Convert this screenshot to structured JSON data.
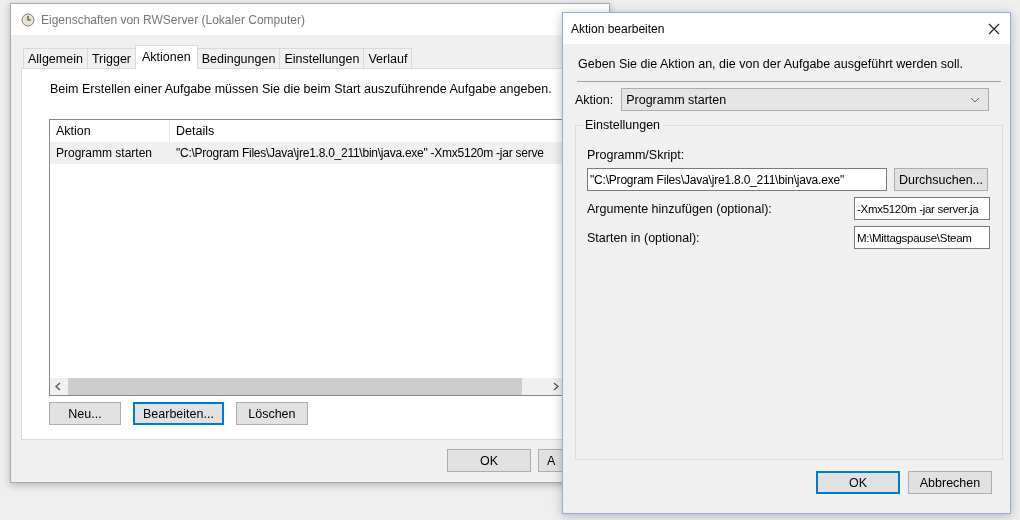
{
  "main_window": {
    "title": "Eigenschaften von RWServer (Lokaler Computer)",
    "tabs": [
      {
        "label": "Allgemein",
        "selected": false
      },
      {
        "label": "Trigger",
        "selected": false
      },
      {
        "label": "Aktionen",
        "selected": true
      },
      {
        "label": "Bedingungen",
        "selected": false
      },
      {
        "label": "Einstellungen",
        "selected": false
      },
      {
        "label": "Verlauf",
        "selected": false
      }
    ],
    "instruction": "Beim Erstellen einer Aufgabe müssen Sie die beim Start auszuführende Aufgabe angeben.",
    "actions_table": {
      "columns": [
        "Aktion",
        "Details"
      ],
      "rows": [
        {
          "cells": [
            "Programm starten",
            "\"C:\\Program Files\\Java\\jre1.8.0_211\\bin\\java.exe\" -Xmx5120m -jar serve"
          ],
          "selected": true
        }
      ]
    },
    "buttons": [
      {
        "label": "Neu...",
        "focused": false
      },
      {
        "label": "Bearbeiten...",
        "focused": true
      },
      {
        "label": "Löschen",
        "focused": false
      }
    ],
    "footer_buttons": [
      "OK",
      "A"
    ]
  },
  "dialog": {
    "title": "Aktion bearbeiten",
    "instruction": "Geben Sie die Aktion an, die von der Aufgabe ausgeführt werden soll.",
    "action_label": "Aktion:",
    "action_value": "Programm starten",
    "group_label": "Einstellungen",
    "program_label": "Programm/Skript:",
    "program_value": "\"C:\\Program Files\\Java\\jre1.8.0_211\\bin\\java.exe\"",
    "browse_button": "Durchsuchen...",
    "arguments_label": "Argumente hinzufügen (optional):",
    "arguments_value": "-Xmx5120m -jar server.ja",
    "start_in_label": "Starten in (optional):",
    "start_in_value": "M:\\Mittagspause\\Steam",
    "buttons": [
      {
        "label": "OK",
        "focused": true
      },
      {
        "label": "Abbrechen",
        "focused": false
      }
    ]
  }
}
